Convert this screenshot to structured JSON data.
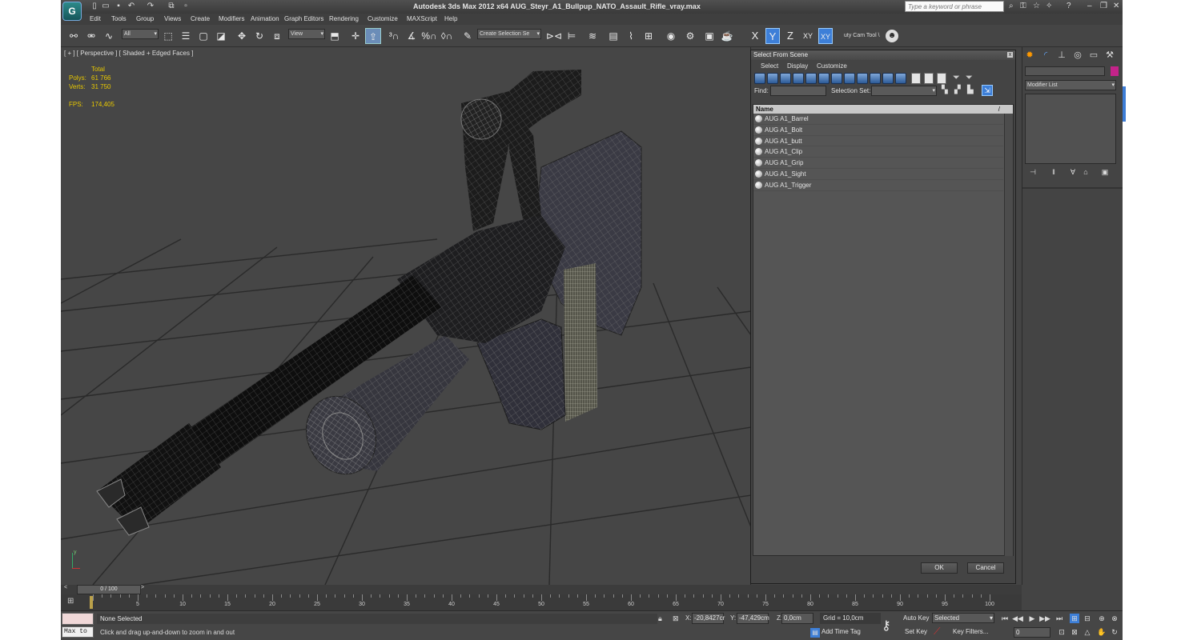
{
  "window": {
    "title": "Autodesk 3ds Max  2012 x64      AUG_Steyr_A1_Bullpup_NATO_Assault_Rifle_vray.max",
    "logo": "G",
    "help_search_placeholder": "Type a keyword or phrase"
  },
  "menubar": [
    "Edit",
    "Tools",
    "Group",
    "Views",
    "Create",
    "Modifiers",
    "Animation",
    "Graph Editors",
    "Rendering",
    "Customize",
    "MAXScript",
    "Help"
  ],
  "toolbar": {
    "selection_filter": "All",
    "ref_coord": "View",
    "named_selection": "Create Selection Se",
    "axis_x": "X",
    "axis_y": "Y",
    "axis_z": "Z",
    "axis_xy": "XY",
    "axis_xy2": "XY",
    "camera_tool": "uty Cam Tool \\"
  },
  "viewport": {
    "label": "[ + ] [ Perspective ] [ Shaded + Edged Faces ]",
    "stats": {
      "header": "Total",
      "polys_label": "Polys:",
      "polys": "61 766",
      "verts_label": "Verts:",
      "verts": "31 750",
      "fps_label": "FPS:",
      "fps": "174,405"
    },
    "axis_y": "y"
  },
  "dialog": {
    "title": "Select From Scene",
    "close": "x",
    "menu": [
      "Select",
      "Display",
      "Customize"
    ],
    "find_label": "Find:",
    "selection_set_label": "Selection Set:",
    "column_name": "Name",
    "sort_mark": "/",
    "objects": [
      "AUG A1_Barrel",
      "AUG A1_Bolt",
      "AUG A1_butt",
      "AUG A1_Clip",
      "AUG A1_Grip",
      "AUG A1_Sight",
      "AUG A1_Trigger"
    ],
    "ok": "OK",
    "cancel": "Cancel"
  },
  "command_panel": {
    "modifier_list": "Modifier List",
    "object_color": "#c4238a"
  },
  "timeline": {
    "slider": "0 / 100",
    "prev": "<",
    "next": ">",
    "ticks": [
      5,
      10,
      15,
      20,
      25,
      30,
      35,
      40,
      45,
      50,
      55,
      60,
      65,
      70,
      75,
      80,
      85,
      90,
      95,
      100
    ]
  },
  "status": {
    "maxscript_label": "Max to",
    "selection": "None Selected",
    "prompt": "Click and drag up-and-down to zoom in and out",
    "x_label": "X:",
    "x": "-20,8427cr",
    "y_label": "Y:",
    "y": "-47,429cm",
    "z_label": "Z:",
    "z": "0,0cm",
    "grid": "Grid = 10,0cm",
    "add_time_tag": "Add Time Tag",
    "auto_key": "Auto Key",
    "set_key": "Set Key",
    "key_mode": "Selected",
    "key_filters": "Key Filters...",
    "frame": "0"
  }
}
